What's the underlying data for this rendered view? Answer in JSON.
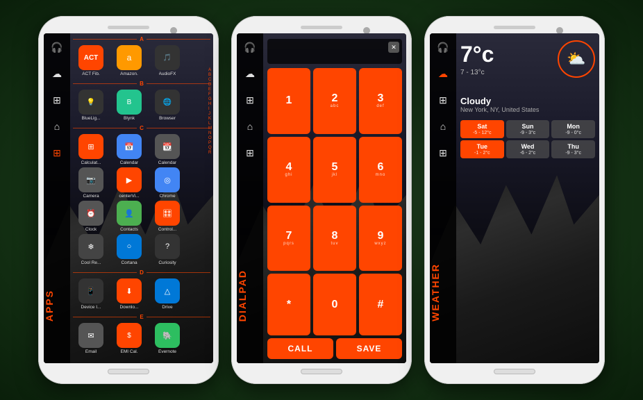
{
  "phones": [
    {
      "id": "apps",
      "screen_label": "APPS",
      "sidebar_icons": [
        "🎧",
        "☁",
        "⊞",
        "⌂",
        "⊞"
      ],
      "sections": {
        "A": [
          "ACT Fib.",
          "Amazon.",
          "AudioFX"
        ],
        "B": [
          "BlueLig...",
          "Blynk",
          "Browser"
        ],
        "C": [
          "Calculat...",
          "Calendar",
          "Calendar",
          "Camera",
          "centerVi...",
          "Chrome",
          "Clock",
          "Contacts",
          "Control...",
          "Cool Re...",
          "Cortana",
          "Curiosity"
        ],
        "D": [
          "Device I...",
          "Downlo...",
          "Drive"
        ],
        "E": [
          "Email",
          "EMI Cal.",
          "Evernote"
        ]
      },
      "alpha": [
        "A",
        "B",
        "C",
        "D",
        "E",
        "F",
        "G",
        "H",
        "I",
        "J",
        "K",
        "L",
        "M",
        "N",
        "O",
        "P",
        "Q",
        "R"
      ]
    },
    {
      "id": "dialpad",
      "screen_label": "DIALPAD",
      "sidebar_icons": [
        "🎧",
        "☁",
        "⊞",
        "⌂",
        "⊞"
      ],
      "keys": [
        {
          "num": "1",
          "sub": ""
        },
        {
          "num": "2",
          "sub": "abc"
        },
        {
          "num": "3",
          "sub": "def"
        },
        {
          "num": "4",
          "sub": "ghi"
        },
        {
          "num": "5",
          "sub": "jkl"
        },
        {
          "num": "6",
          "sub": "mno"
        },
        {
          "num": "7",
          "sub": "pqrs"
        },
        {
          "num": "8",
          "sub": "tuv"
        },
        {
          "num": "9",
          "sub": "wxyz"
        },
        {
          "num": "*",
          "sub": ""
        },
        {
          "num": "0",
          "sub": ""
        },
        {
          "num": "#",
          "sub": ""
        }
      ],
      "actions": [
        "CALL",
        "SAVE"
      ]
    },
    {
      "id": "weather",
      "screen_label": "WEATHER",
      "sidebar_icons": [
        "🎧",
        "☁",
        "⊞",
        "⌂",
        "⊞"
      ],
      "current": {
        "temp": "7°c",
        "range": "7 - 13°c",
        "condition": "Cloudy",
        "location": "New York, NY, United States",
        "icon": "⛅"
      },
      "forecast": [
        {
          "day": "Sat",
          "temp": "-5 - 12°c",
          "highlight": true
        },
        {
          "day": "Sun",
          "temp": "-9 - 3°c",
          "highlight": false
        },
        {
          "day": "Mon",
          "temp": "-9 - 0°c",
          "highlight": false
        },
        {
          "day": "Tue",
          "temp": "-1 - 2°c",
          "highlight": true
        },
        {
          "day": "Wed",
          "temp": "-6 - 2°c",
          "highlight": false
        },
        {
          "day": "Thu",
          "temp": "-9 - 3°c",
          "highlight": false
        }
      ]
    }
  ]
}
